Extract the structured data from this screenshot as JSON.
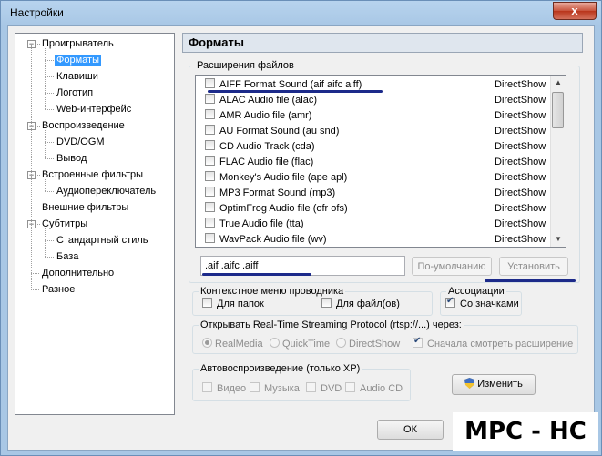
{
  "window": {
    "title": "Настройки",
    "close": "x"
  },
  "tree": [
    {
      "label": "Проигрыватель",
      "level": 0,
      "expander": "−"
    },
    {
      "label": "Форматы",
      "level": 1,
      "selected": true
    },
    {
      "label": "Клавиши",
      "level": 1
    },
    {
      "label": "Логотип",
      "level": 1
    },
    {
      "label": "Web-интерфейс",
      "level": 1
    },
    {
      "label": "Воспроизведение",
      "level": 0,
      "expander": "−"
    },
    {
      "label": "DVD/OGM",
      "level": 1
    },
    {
      "label": "Вывод",
      "level": 1
    },
    {
      "label": "Встроенные фильтры",
      "level": 0,
      "expander": "−"
    },
    {
      "label": "Аудиопереключатель",
      "level": 1
    },
    {
      "label": "Внешние фильтры",
      "level": 0
    },
    {
      "label": "Субтитры",
      "level": 0,
      "expander": "−"
    },
    {
      "label": "Стандартный стиль",
      "level": 1
    },
    {
      "label": "База",
      "level": 1
    },
    {
      "label": "Дополнительно",
      "level": 0
    },
    {
      "label": "Разное",
      "level": 0
    }
  ],
  "header": {
    "title": "Форматы"
  },
  "extensions": {
    "legend": "Расширения файлов",
    "items": [
      {
        "name": "AIFF Format Sound (aif aifc aiff)",
        "type": "DirectShow"
      },
      {
        "name": "ALAC Audio file (alac)",
        "type": "DirectShow"
      },
      {
        "name": "AMR Audio file (amr)",
        "type": "DirectShow"
      },
      {
        "name": "AU Format Sound (au snd)",
        "type": "DirectShow"
      },
      {
        "name": "CD Audio Track (cda)",
        "type": "DirectShow"
      },
      {
        "name": "FLAC Audio file (flac)",
        "type": "DirectShow"
      },
      {
        "name": "Monkey's Audio file (ape apl)",
        "type": "DirectShow"
      },
      {
        "name": "MP3 Format Sound (mp3)",
        "type": "DirectShow"
      },
      {
        "name": "OptimFrog Audio file (ofr ofs)",
        "type": "DirectShow"
      },
      {
        "name": "True Audio file (tta)",
        "type": "DirectShow"
      },
      {
        "name": "WavPack Audio file (wv)",
        "type": "DirectShow"
      }
    ],
    "ext_value": ".aif .aifc .aiff",
    "default_button": "По-умолчанию",
    "set_button": "Установить"
  },
  "context_menu": {
    "legend": "Контекстное меню проводника",
    "folders": "Для папок",
    "files": "Для файл(ов)"
  },
  "associations": {
    "legend": "Ассоциации",
    "with_icons": "Со значками"
  },
  "rtsp": {
    "legend": "Открывать Real-Time Streaming Protocol (rtsp://...) через:",
    "realmedia": "RealMedia",
    "quicktime": "QuickTime",
    "directshow": "DirectShow",
    "check_ext": "Сначала смотреть расширение"
  },
  "autoplay": {
    "legend": "Автовоспроизведение (только XP)",
    "video": "Видео",
    "music": "Музыка",
    "dvd": "DVD",
    "audiocd": "Audio CD"
  },
  "change_button": "Изменить",
  "ok_button": "ОК",
  "watermark": "MPC - HC",
  "colors": {
    "selection": "#3399ff",
    "annotation": "#1c2a8a",
    "titlebar": "#a8c7e5"
  }
}
